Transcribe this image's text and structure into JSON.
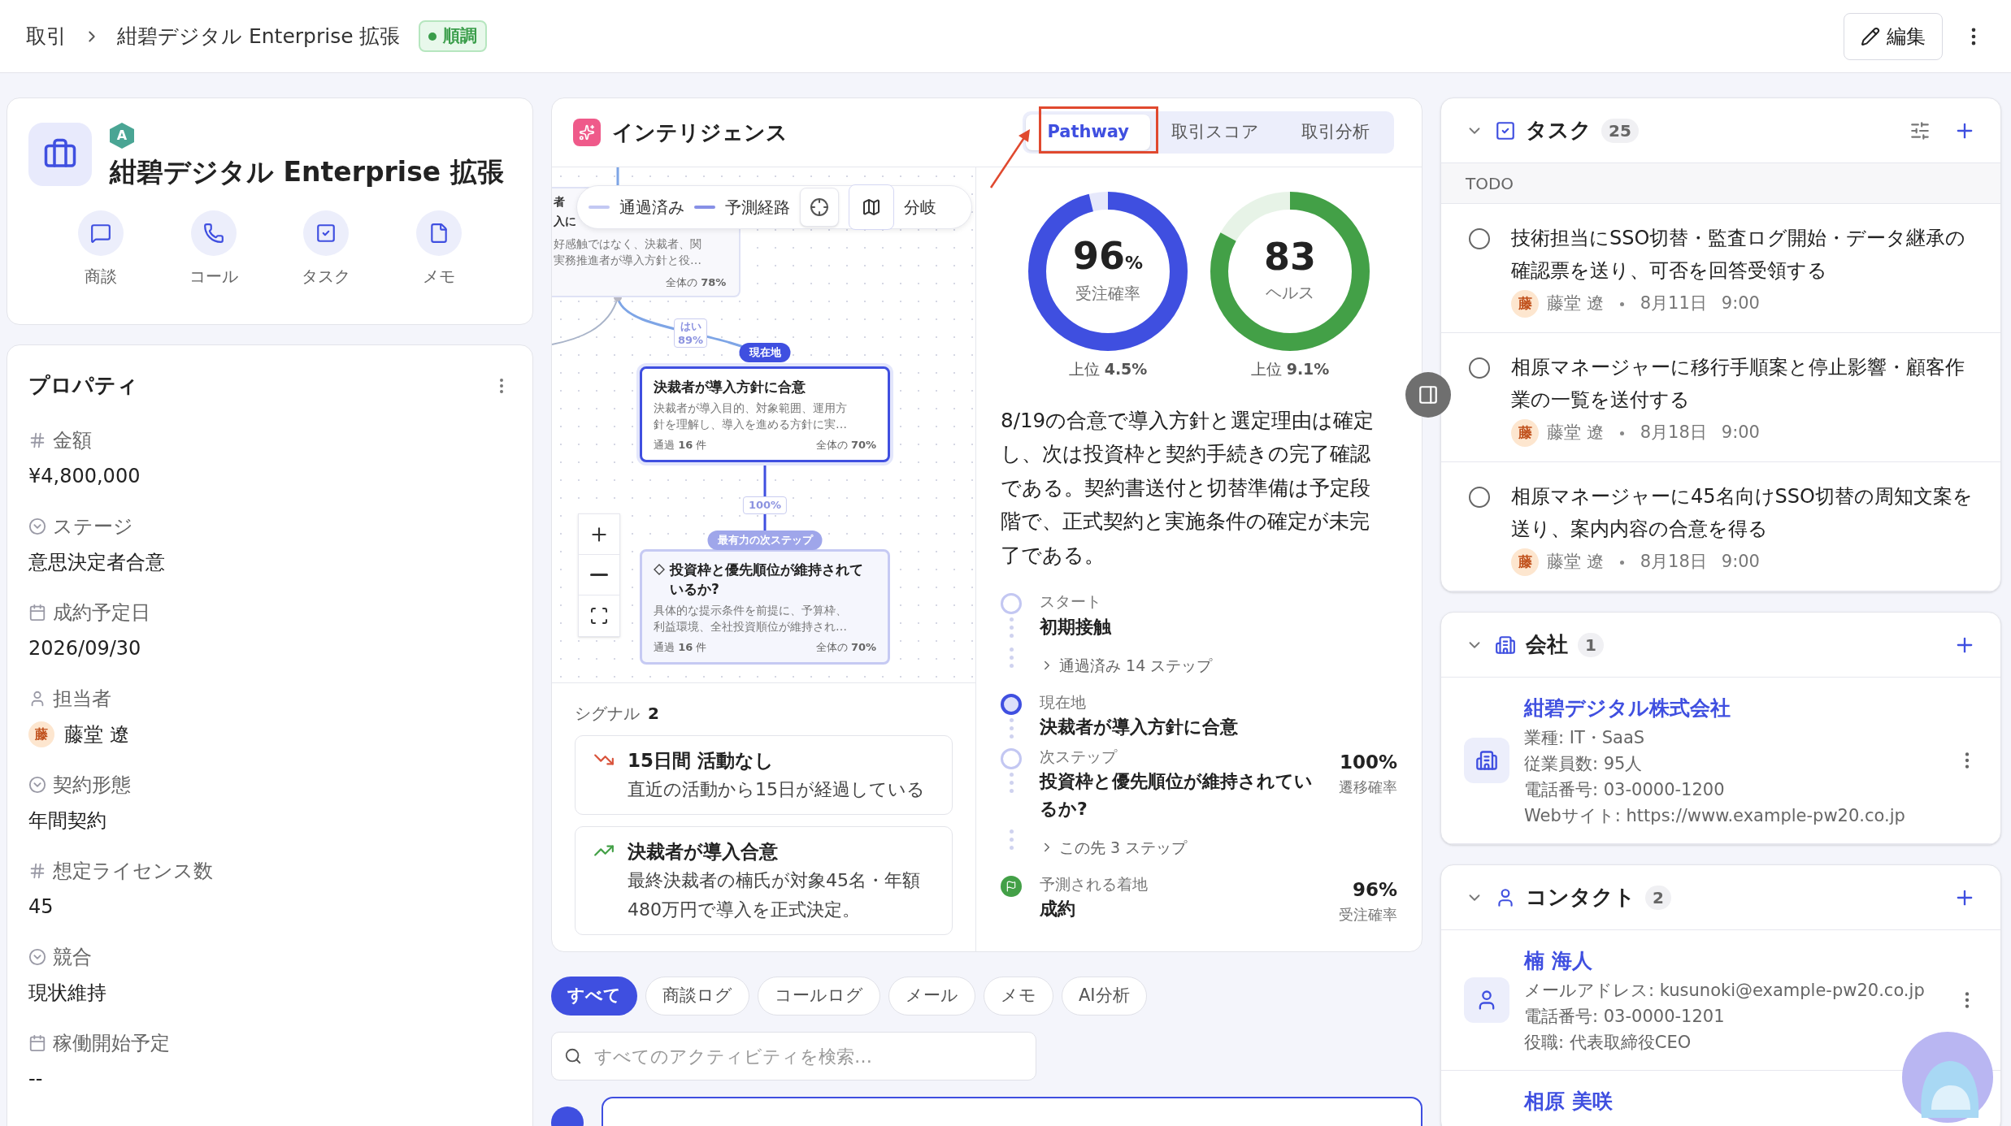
{
  "breadcrumb": {
    "items": [
      "取引",
      "紺碧デジタル Enterprise 拡張"
    ],
    "status": {
      "label": "順調",
      "color": "#3a9d4a"
    }
  },
  "header_actions": {
    "edit": "編集"
  },
  "deal": {
    "tier": "A",
    "title": "紺碧デジタル Enterprise 拡張",
    "actions": [
      {
        "kind": "chat",
        "label": "商談"
      },
      {
        "kind": "phone",
        "label": "コール"
      },
      {
        "kind": "task",
        "label": "タスク"
      },
      {
        "kind": "memo",
        "label": "メモ"
      }
    ]
  },
  "properties": {
    "title": "プロパティ",
    "items": [
      {
        "kind": "number",
        "label": "金額",
        "value": "¥4,800,000"
      },
      {
        "kind": "select",
        "label": "ステージ",
        "value": "意思決定者合意"
      },
      {
        "kind": "date",
        "label": "成約予定日",
        "value": "2026/09/30"
      },
      {
        "kind": "person",
        "label": "担当者",
        "value": "藤堂 遼",
        "avatar": "藤"
      },
      {
        "kind": "select",
        "label": "契約形態",
        "value": "年間契約"
      },
      {
        "kind": "number",
        "label": "想定ライセンス数",
        "value": "45"
      },
      {
        "kind": "select",
        "label": "競合",
        "value": "現状維持"
      },
      {
        "kind": "date",
        "label": "稼働開始予定",
        "value": "--"
      }
    ]
  },
  "intelligence": {
    "title": "インテリジェンス",
    "tabs": [
      {
        "label": "Pathway",
        "selected": true
      },
      {
        "label": "取引スコア",
        "selected": false
      },
      {
        "label": "取引分析",
        "selected": false
      }
    ],
    "graph": {
      "legend": [
        {
          "kind": "passed",
          "label": "通過済み"
        },
        {
          "kind": "predicted",
          "label": "予測経路"
        }
      ],
      "branch_label": "分岐",
      "partial_node": {
        "title_fragments": [
          "者",
          "入に"
        ],
        "description": [
          "好感触ではなく、決裁者、関",
          "実務推進者が導入方針と役…"
        ],
        "share": "全体の **78%**"
      },
      "edges": [
        {
          "label": [
            "はい",
            "89%"
          ]
        },
        {
          "label": [
            "100%"
          ]
        }
      ],
      "nodes": [
        {
          "kind": "current",
          "badge": "現在地",
          "title": "決裁者が導入方針に合意",
          "description": [
            "決裁者が導入目的、対象範囲、運用方",
            "針を理解し、導入を進める方針に実…"
          ],
          "passed": "通過 **16** 件",
          "share": "全体の **70%**"
        },
        {
          "kind": "next",
          "badge": "最有力の次ステップ",
          "title": "投資枠と優先順位が維持されているか?",
          "description": [
            "具体的な提示条件を前提に、予算枠、",
            "利益環境、全社投資順位が維持され…"
          ],
          "passed": "通過 **16** 件",
          "share": "全体の **70%**"
        }
      ]
    },
    "signals": {
      "title": "シグナル",
      "count": "2",
      "items": [
        {
          "kind": "down",
          "title": "15日間 活動なし",
          "text": "直近の活動から15日が経過している"
        },
        {
          "kind": "up",
          "title": "決裁者が導入合意",
          "text": "最終決裁者の楠氏が対象45名・年額480万円で導入を正式決定。"
        }
      ]
    },
    "scores": [
      {
        "value": "96",
        "unit": "%",
        "label": "受注確率",
        "level": 0.96,
        "color": "#3f4fe0",
        "rank": "上位 **4.5%**"
      },
      {
        "value": "83",
        "label": "ヘルス",
        "level": 0.83,
        "color": "#43a047",
        "rank": "上位 **9.1%**"
      }
    ],
    "summary": "8/19の合意で導入方針と選定理由は確定し、次は投資枠と契約手続きの完了確認である。契約書送付と切替準備は予定段階で、正式契約と実施条件の確定が未完了である。",
    "pathway": [
      {
        "kind": "start",
        "caption": "スタート",
        "title": "初期接触"
      },
      {
        "kind": "collapsed",
        "label": "通過済み 14 ステップ"
      },
      {
        "kind": "current",
        "caption": "現在地",
        "title": "決裁者が導入方針に合意"
      },
      {
        "kind": "next",
        "caption": "次ステップ",
        "title": "投資枠と優先順位が維持されているか?",
        "value": "100%",
        "value_label": "遷移確率"
      },
      {
        "kind": "collapsed",
        "label": "この先 3 ステップ"
      },
      {
        "kind": "landing",
        "caption": "予測される着地",
        "title": "成約",
        "value": "96%",
        "value_label": "受注確率"
      }
    ]
  },
  "activity": {
    "filters": [
      {
        "label": "すべて",
        "selected": true
      },
      {
        "label": "商談ログ",
        "selected": false
      },
      {
        "label": "コールログ",
        "selected": false
      },
      {
        "label": "メール",
        "selected": false
      },
      {
        "label": "メモ",
        "selected": false
      },
      {
        "label": "AI分析",
        "selected": false
      }
    ],
    "search": {
      "placeholder": "すべてのアクティビティを検索…"
    }
  },
  "tasks": {
    "title": "タスク",
    "count": "25",
    "group": "TODO",
    "items": [
      {
        "text": "技術担当にSSO切替・監査ログ開始・データ継承の確認票を送り、可否を回答受領する",
        "done": false,
        "avatar": "藤",
        "owner": "藤堂 遼",
        "date": "8月11日",
        "time": "9:00"
      },
      {
        "text": "相原マネージャーに移行手順案と停止影響・顧客作業の一覧を送付する",
        "done": false,
        "avatar": "藤",
        "owner": "藤堂 遼",
        "date": "8月18日",
        "time": "9:00"
      },
      {
        "text": "相原マネージャーに45名向けSSO切替の周知文案を送り、案内内容の合意を得る",
        "done": false,
        "avatar": "藤",
        "owner": "藤堂 遼",
        "date": "8月18日",
        "time": "9:00"
      }
    ]
  },
  "company": {
    "title": "会社",
    "count": "1",
    "items": [
      {
        "name": "紺碧デジタル株式会社",
        "details": [
          "業種: IT・SaaS",
          "従業員数: 95人",
          "電話番号: 03-0000-1200",
          "Webサイト: https://www.example-pw20.co.jp"
        ]
      }
    ]
  },
  "contacts": {
    "title": "コンタクト",
    "count": "2",
    "items": [
      {
        "name": "楠 海人",
        "details": [
          "メールアドレス: kusunoki@example-pw20.co.jp",
          "電話番号: 03-0000-1201",
          "役職: 代表取締役CEO"
        ]
      },
      {
        "name": "相原 美咲"
      }
    ]
  }
}
